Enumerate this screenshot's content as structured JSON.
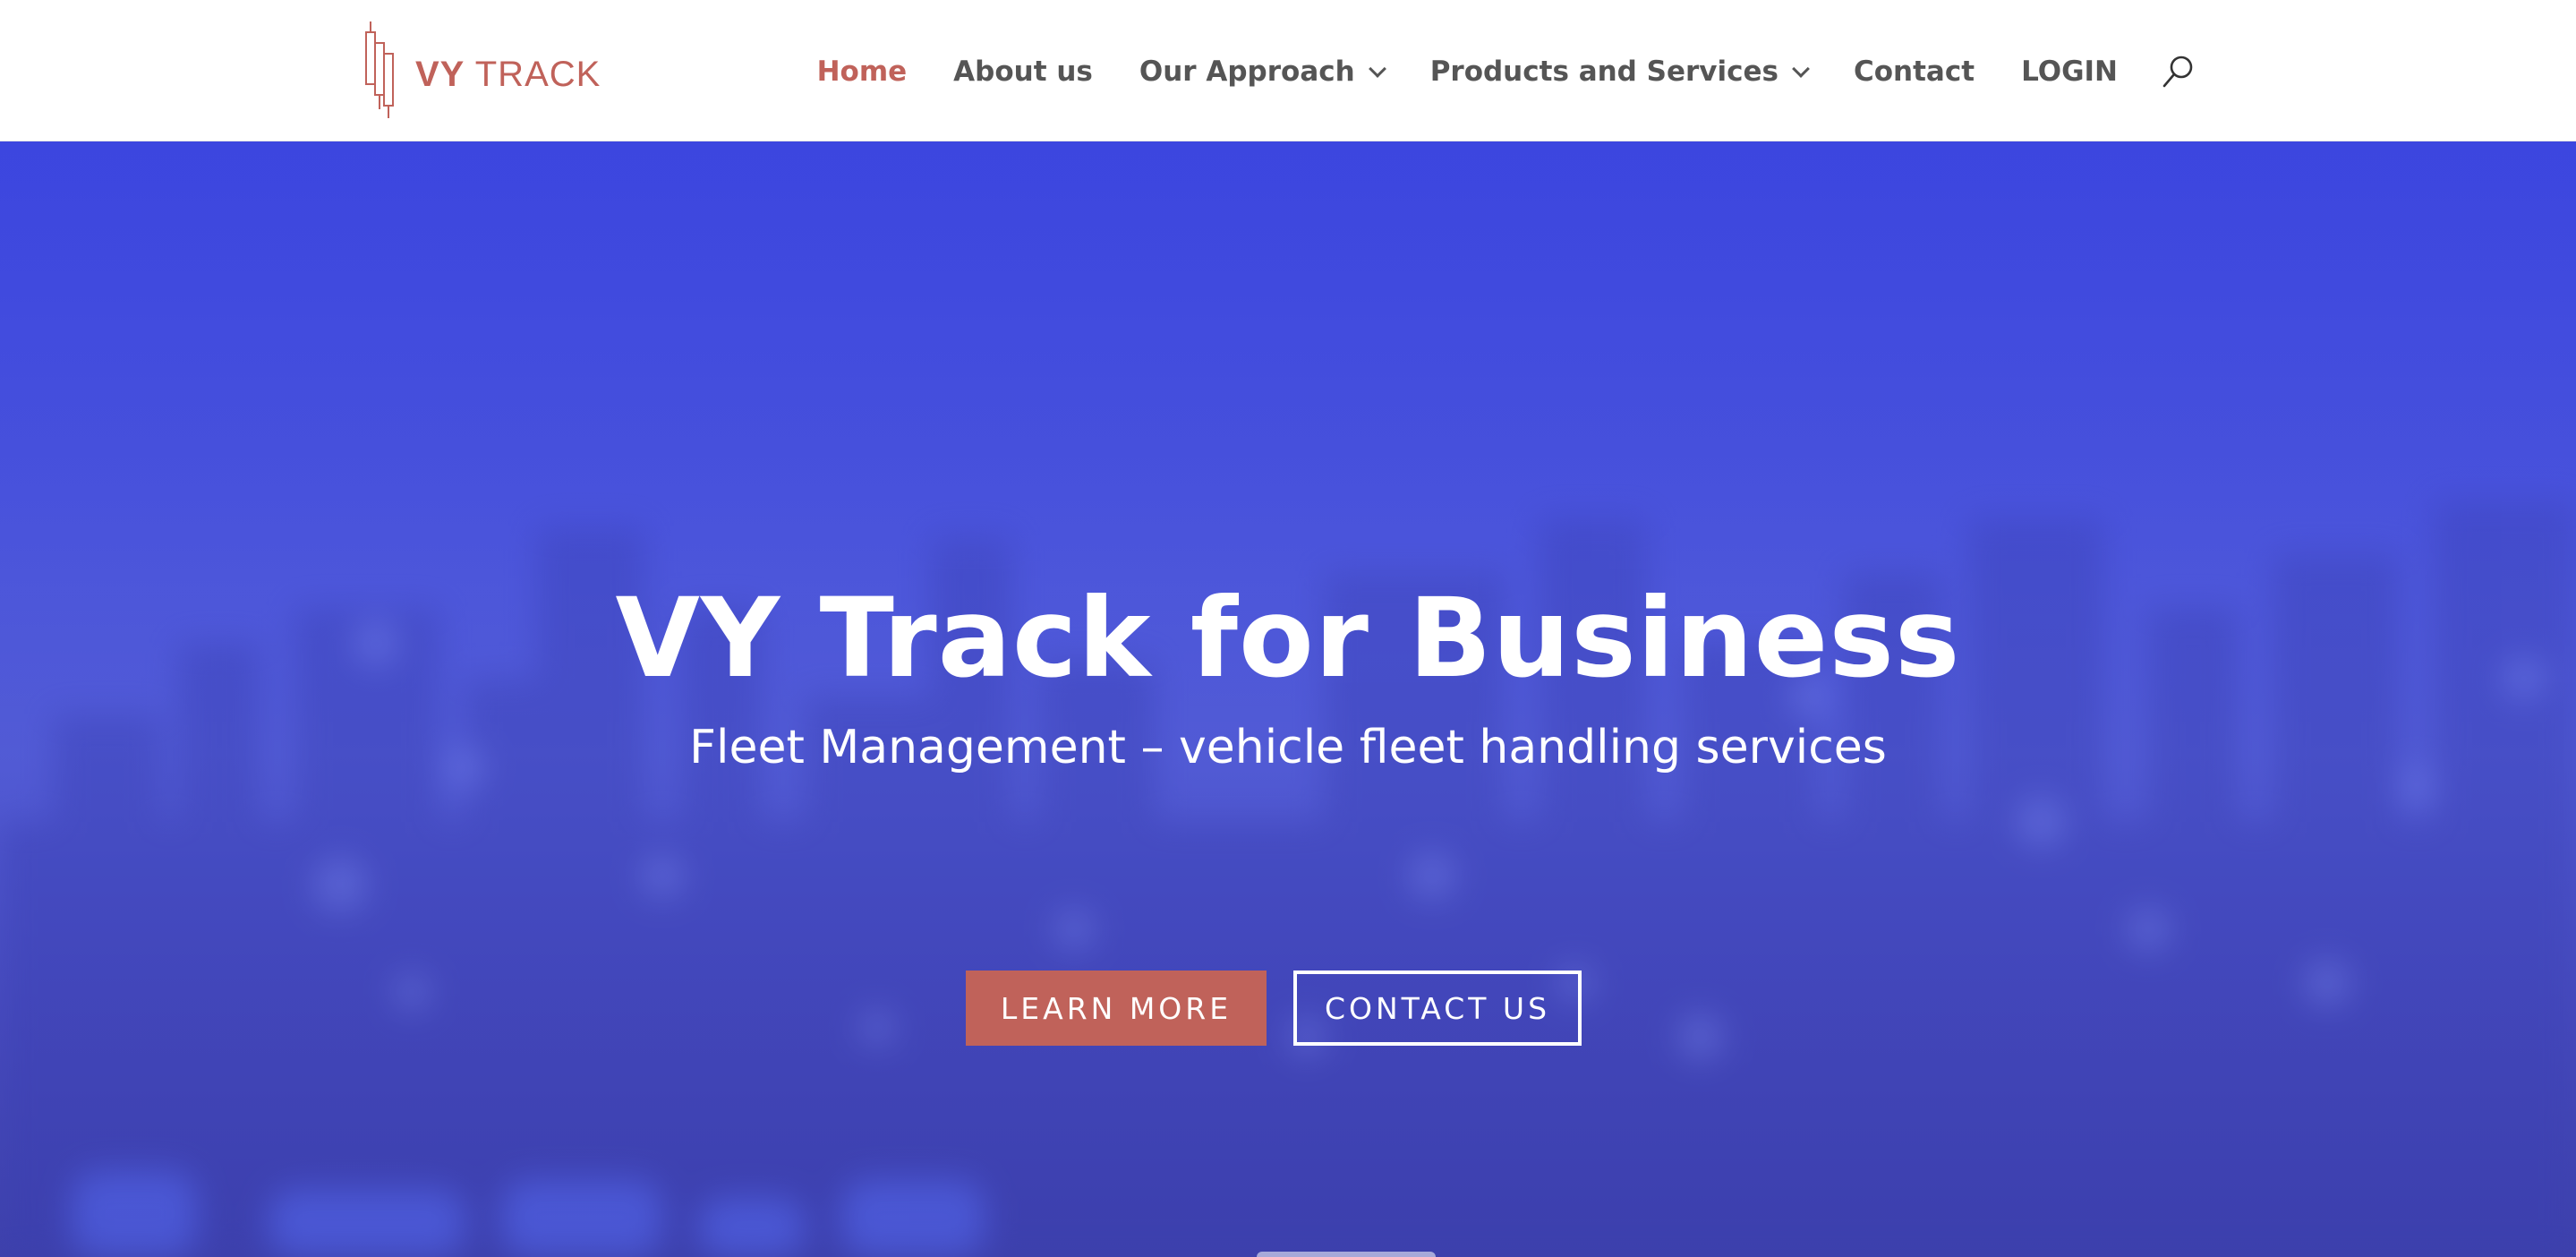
{
  "brand": {
    "logo_bold": "VY",
    "logo_light": "TRACK",
    "accent_color": "#c0625a"
  },
  "nav": {
    "items": [
      {
        "label": "Home",
        "active": true,
        "has_dropdown": false
      },
      {
        "label": "About us",
        "active": false,
        "has_dropdown": false
      },
      {
        "label": "Our Approach",
        "active": false,
        "has_dropdown": true
      },
      {
        "label": "Products and Services",
        "active": false,
        "has_dropdown": true
      },
      {
        "label": "Contact",
        "active": false,
        "has_dropdown": false
      },
      {
        "label": "LOGIN",
        "active": false,
        "has_dropdown": false
      }
    ],
    "search_icon": "search-icon"
  },
  "hero": {
    "title": "VY Track for Business",
    "subtitle": "Fleet Management – vehicle fleet handling services",
    "primary_button": "LEARN MORE",
    "secondary_button": "CONTACT US",
    "background_color": "#4450d8"
  }
}
